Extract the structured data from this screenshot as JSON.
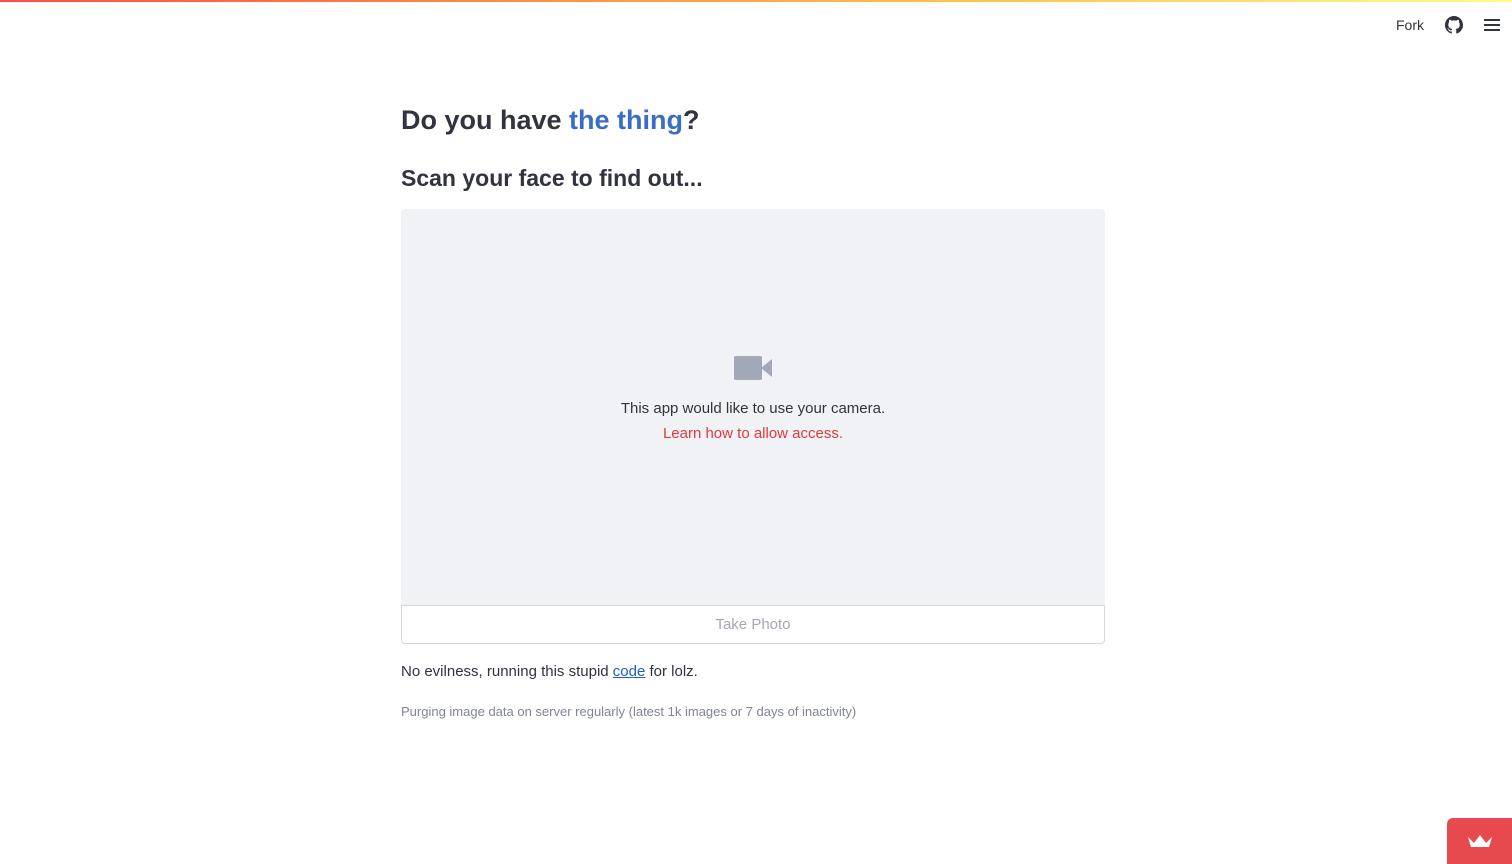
{
  "header": {
    "fork_label": "Fork",
    "github_icon": "github-icon",
    "menu_icon": "hamburger-menu-icon",
    "decoration_colors": [
      "#ff4b4b",
      "#ffbd45",
      "#fffd80"
    ]
  },
  "main": {
    "title_prefix": "Do you have ",
    "title_accent": "the thing",
    "title_suffix": "?",
    "subtitle": "Scan your face to find out...",
    "camera": {
      "icon": "video-camera-icon",
      "message": "This app would like to use your camera.",
      "learn_link": "Learn how to allow access.",
      "button_label": "Take Photo"
    },
    "note": {
      "prefix": "No evilness, running this stupid ",
      "link": "code",
      "suffix": " for lolz."
    },
    "caption": "Purging image data on server regularly (latest 1k images or 7 days of inactivity)"
  },
  "badge": {
    "icon": "crown-icon"
  },
  "colors": {
    "accent_blue": "#3a6dc5",
    "link_red": "#e0393e",
    "badge_red": "#e64a4e",
    "camera_bg": "#f0f2f6"
  }
}
